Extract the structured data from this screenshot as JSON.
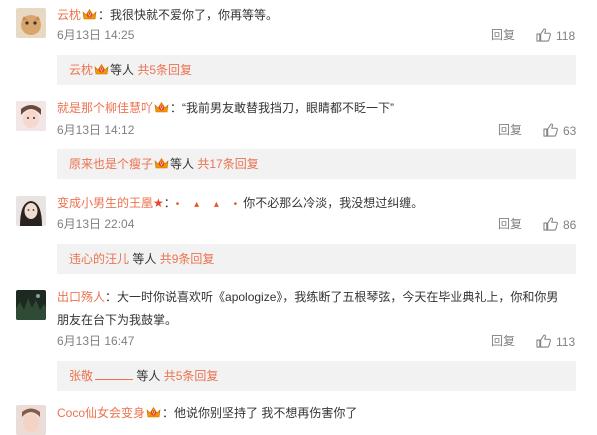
{
  "comments": [
    {
      "user": "云枕",
      "text": "：我很快就不爱你了，你再等等。",
      "time": "6月13日 14:25",
      "reply": "回复",
      "likes": "118",
      "sub": {
        "user": "云枕",
        "others": "等人",
        "count": "共5条回复"
      }
    },
    {
      "user": "就是那个柳佳慧吖",
      "text": "：“我前男友敢替我挡刀，眼睛都不眨一下”",
      "time": "6月13日 14:12",
      "reply": "回复",
      "likes": "63",
      "sub": {
        "user": "原来也是个瘦子",
        "others": "等人",
        "count": "共17条回复"
      }
    },
    {
      "user": "变成小男生的王凰",
      "dots": "• ▴ ▴ •",
      "text": "你不必那么冷淡，我没想过纠缠。",
      "time": "6月13日 22:04",
      "reply": "回复",
      "likes": "86",
      "sub": {
        "user": "违心的汪儿",
        "others": "等人",
        "count": "共9条回复"
      }
    },
    {
      "user": "出口殇人",
      "text": "：大一时你说喜欢听《apologize》，我练断了五根琴弦，今天在毕业典礼上，你和你男",
      "text2": "朋友在台下为我鼓掌。",
      "time": "6月13日 16:47",
      "reply": "回复",
      "likes": "113",
      "sub": {
        "user": "张敬",
        "others": "等人",
        "count": "共5条回复"
      }
    },
    {
      "user": "Coco仙女会变身",
      "text": "：他说你别坚持了 我不想再伤害你了"
    }
  ],
  "colors": {
    "username": "#eb7350",
    "meta": "#808080",
    "subbox_bg": "#f2f2f2"
  },
  "icons": {
    "like": "thumbs-up-icon",
    "vip": "vip-crown-icon"
  }
}
